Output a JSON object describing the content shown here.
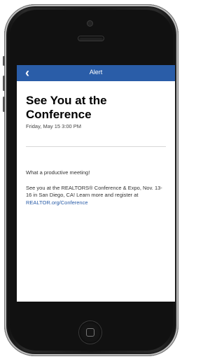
{
  "alert": {
    "back_icon": "‹",
    "nav_title": "Alert",
    "title": "See You at the Conference",
    "date": "Friday, May 15 3:00 PM",
    "paragraph1": "What a productive meeting!",
    "paragraph2": "See you at the REALTORS® Conference & Expo, Nov. 13-16 in San Diego, CA! Learn more and register at",
    "link_text": "REALTOR.org/Conference"
  },
  "colors": {
    "accent": "#2a5da8",
    "phone_body": "#1a1a1a",
    "screen_bg": "#ffffff"
  },
  "icons": [
    "back-chevron-icon",
    "home-button-icon",
    "camera-icon",
    "speaker-icon"
  ]
}
